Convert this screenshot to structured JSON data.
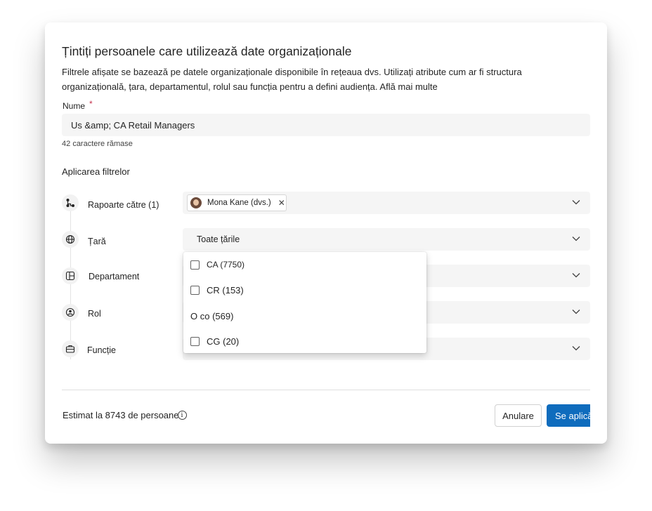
{
  "dialog": {
    "title": "Țintiți persoanele care utilizează date organizaționale",
    "description": "Filtrele afișate se bazează pe datele organizaționale disponibile în rețeaua dvs. Utilizați atribute cum ar fi structura organizațională, țara, departamentul, rolul sau funcția pentru a defini audiența. Află mai multe"
  },
  "name_field": {
    "label": "Nume",
    "required_mark": "*",
    "value": "Us &amp; CA Retail Managers",
    "chars_remaining_count": "42",
    "chars_remaining_text": "caractere rămase"
  },
  "filters": {
    "heading": "Aplicarea filtrelor",
    "reports_to": {
      "label": "Rapoarte către (1)",
      "icon": "org-chart-icon",
      "chip": {
        "text": "Mona Kane (dvs.)",
        "remove": "✕"
      }
    },
    "country": {
      "label": "Țară",
      "icon": "globe-icon",
      "selected": "Toate țările",
      "options": [
        {
          "label": "CA (7750)",
          "checked": false
        },
        {
          "label": "CR (153)",
          "checked": false
        },
        {
          "label": "O co (569)"
        },
        {
          "label": "CG (20)",
          "checked": false
        }
      ]
    },
    "department": {
      "label": "Departament",
      "icon": "department-icon"
    },
    "role": {
      "label": "Rol",
      "icon": "role-icon"
    },
    "function": {
      "label": "Funcție",
      "icon": "briefcase-icon"
    }
  },
  "footer": {
    "estimate": "Estimat la 8743 de persoane",
    "info_glyph": "i",
    "cancel": "Anulare",
    "apply": "Se aplică"
  },
  "colors": {
    "accent": "#0f6cbd",
    "required": "#c4314b",
    "field_bg": "#f5f5f5"
  }
}
